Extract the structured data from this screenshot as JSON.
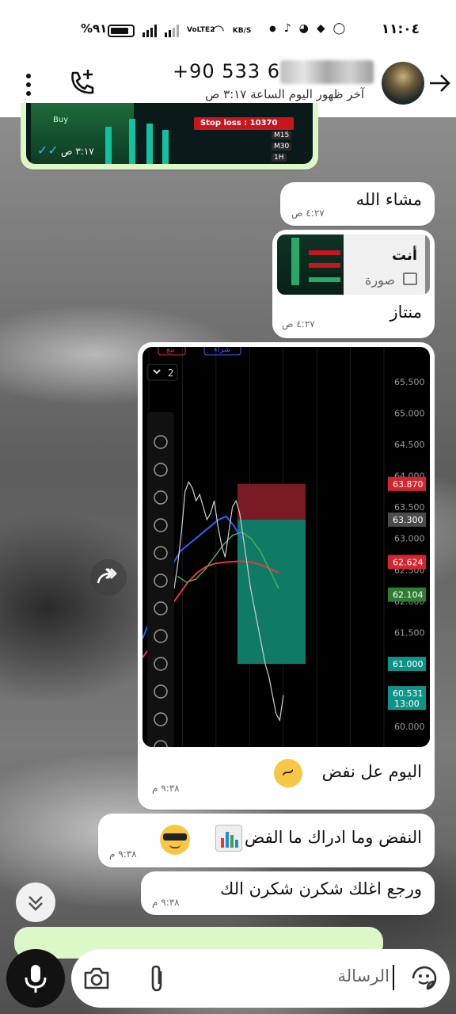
{
  "status_bar": {
    "time": "١١:٠٤",
    "battery": "%٩١",
    "network_speed": "KB/S",
    "volte": "VoLTE2"
  },
  "header": {
    "contact_number": "+90 533 6",
    "last_seen": "آخر ظهور اليوم الساعة ٣:١٧ ص"
  },
  "messages": [
    {
      "id": "m0",
      "direction": "out",
      "time": "٣:١٧ ص",
      "image_labels": [
        "Buy",
        "Stop loss : 10370",
        "M15",
        "M30",
        "1H"
      ]
    },
    {
      "id": "m1",
      "direction": "in",
      "text": "مشاء الله",
      "time": "٤:٢٧ ص"
    },
    {
      "id": "m2",
      "direction": "in",
      "reply_to": "أنت",
      "reply_type": "صورة",
      "text": "منتاز",
      "time": "٤:٢٧ ص"
    },
    {
      "id": "m3",
      "direction": "in",
      "text": "اليوم عل نفض",
      "time": "٩:٣٨ م"
    },
    {
      "id": "m4",
      "direction": "in",
      "text": "النفض وما ادراك ما الفض",
      "time": "٩:٣٨ م"
    },
    {
      "id": "m5",
      "direction": "in",
      "text": "ورجع اغلك شكرن شكرن الك",
      "time": "٩:٣٨ م"
    }
  ],
  "chart_data": {
    "type": "line",
    "top_buttons": [
      "بيع",
      "شراء"
    ],
    "interval_label": "2",
    "y_ticks": [
      "65.500",
      "65.000",
      "64.500",
      "64.000",
      "63.500",
      "63.000",
      "62.500",
      "62.000",
      "61.500",
      "60.000"
    ],
    "price_labels": [
      {
        "value": "63.870",
        "color": "#d5262f"
      },
      {
        "value": "63.300",
        "color": "#4b4b4b"
      },
      {
        "value": "62.624",
        "color": "#d5262f"
      },
      {
        "value": "62.104",
        "color": "#2e7d32"
      },
      {
        "value": "61.000",
        "color": "#0d9488"
      },
      {
        "value": "60.531",
        "sub": "13:00",
        "color": "#0d9488"
      }
    ],
    "ylim": [
      59.8,
      65.8
    ],
    "price_series": [
      62.2,
      62.6,
      63.1,
      63.75,
      63.9,
      63.8,
      63.6,
      63.7,
      63.5,
      63.3,
      63.4,
      63.6,
      63.2,
      62.9,
      62.7,
      63.1,
      63.5,
      63.6,
      63.4,
      63.0,
      62.6,
      62.2,
      61.9,
      61.6,
      61.3,
      61.0,
      60.8,
      60.5,
      60.2,
      60.1,
      60.5
    ],
    "ma_blue": [
      61.4,
      61.7,
      62.0,
      62.3,
      62.6,
      62.8,
      62.9,
      63.0,
      63.1,
      63.2,
      63.3,
      63.35,
      63.2,
      63.0
    ],
    "ma_red": [
      61.1,
      61.3,
      61.6,
      61.9,
      62.1,
      62.3,
      62.45,
      62.55,
      62.6,
      62.62,
      62.63,
      62.64,
      62.62,
      62.58,
      62.52,
      62.45
    ],
    "ma_green": [
      62.4,
      62.3,
      62.35,
      62.5,
      62.7,
      62.9,
      63.05,
      63.1,
      63.0,
      62.8,
      62.5,
      62.2
    ],
    "stop_zone": [
      63.3,
      63.87
    ],
    "profit_zone": [
      61.0,
      63.3
    ],
    "toolbar_icons": [
      "trend-line-icon",
      "horizontal-line-icon",
      "fib-icon",
      "channel-icon",
      "rectangle-icon",
      "text-icon",
      "levels-icon",
      "ray-icon",
      "arrow-icon",
      "path-icon",
      "line-icon",
      "more-icon"
    ]
  },
  "input": {
    "placeholder": "الرسالة"
  },
  "colors": {
    "bubble_in": "#ffffff",
    "bubble_out": "#dcf8c6",
    "read_tick": "#34b7f1"
  }
}
